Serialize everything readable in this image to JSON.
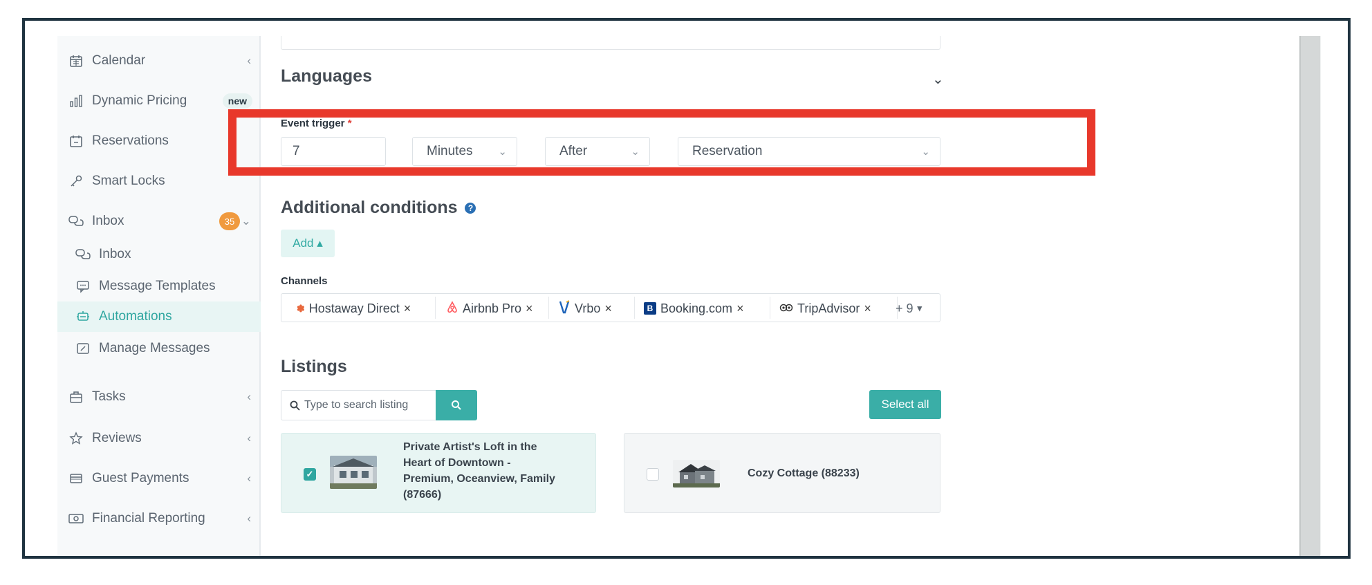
{
  "sidebar": {
    "items": [
      {
        "label": "Calendar",
        "icon": "calendar-icon"
      },
      {
        "label": "Dynamic Pricing",
        "icon": "bar-chart-icon",
        "badge": "new"
      },
      {
        "label": "Reservations",
        "icon": "calendar-check-icon"
      },
      {
        "label": "Smart Locks",
        "icon": "key-icon"
      },
      {
        "label": "Inbox",
        "icon": "chat-icon",
        "badge": "35"
      },
      {
        "label": "Inbox",
        "icon": "chat-icon"
      },
      {
        "label": "Message Templates",
        "icon": "message-template-icon"
      },
      {
        "label": "Automations",
        "icon": "automation-icon"
      },
      {
        "label": "Manage Messages",
        "icon": "edit-message-icon"
      },
      {
        "label": "Tasks",
        "icon": "toolbox-icon"
      },
      {
        "label": "Reviews",
        "icon": "star-icon"
      },
      {
        "label": "Guest Payments",
        "icon": "credit-card-icon"
      },
      {
        "label": "Financial Reporting",
        "icon": "money-icon"
      }
    ]
  },
  "languages": {
    "title": "Languages"
  },
  "event_trigger": {
    "label": "Event trigger",
    "required_mark": "*",
    "value": "7",
    "unit": "Minutes",
    "relation": "After",
    "event": "Reservation"
  },
  "additional_conditions": {
    "title": "Additional conditions",
    "add_label": "Add ▴"
  },
  "channels": {
    "label": "Channels",
    "items": [
      "Hostaway Direct",
      "Airbnb Pro",
      "Vrbo",
      "Booking.com",
      "TripAdvisor"
    ],
    "more": "+ 9"
  },
  "listings": {
    "title": "Listings",
    "search_placeholder": "Type to search listing",
    "select_all": "Select all",
    "cards": [
      {
        "title_lines": [
          "Private Artist's Loft in the",
          "Heart of Downtown -",
          "Premium, Oceanview, Family",
          "(87666)"
        ],
        "checked": true
      },
      {
        "title_lines": [
          "Cozy Cottage (88233)"
        ],
        "checked": false
      }
    ]
  },
  "colors": {
    "accent": "#3aaea7",
    "highlight": "#e8382b",
    "badge": "#f09a3e"
  }
}
